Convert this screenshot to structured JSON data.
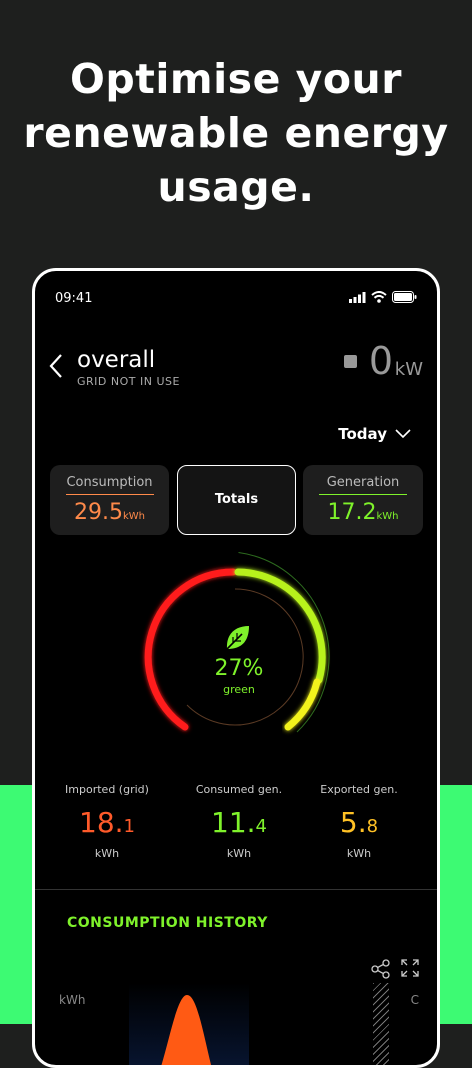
{
  "headline": {
    "line1": "Optimise your",
    "line2": "renewable energy",
    "line3": "usage."
  },
  "status_bar": {
    "time": "09:41"
  },
  "header": {
    "title": "overall",
    "subtitle": "GRID NOT IN USE",
    "power_value": "0",
    "power_unit": "kW"
  },
  "period": {
    "selected": "Today"
  },
  "cards": {
    "consumption": {
      "label": "Consumption",
      "value_main": "29.5",
      "unit": "kWh",
      "color": "#ff8a4a"
    },
    "totals": {
      "label": "Totals"
    },
    "generation": {
      "label": "Generation",
      "value_main": "17.2",
      "unit": "kWh",
      "color": "#7ff22b"
    }
  },
  "gauge": {
    "green_percent": 27,
    "percent_text": "27%",
    "label": "green",
    "colors": {
      "red": "#ff1a1a",
      "green": "#b8f21e",
      "yellow": "#f2f21a",
      "accent": "#7ff22b"
    }
  },
  "stats": {
    "imported": {
      "label": "Imported (grid)",
      "value_main": "18.",
      "value_dec": "1",
      "unit": "kWh",
      "color": "#ff5a2a"
    },
    "consumed_gen": {
      "label": "Consumed gen.",
      "value_main": "11.",
      "value_dec": "4",
      "unit": "kWh",
      "color": "#7ff22b"
    },
    "exported_gen": {
      "label": "Exported gen.",
      "value_main": "5.",
      "value_dec": "8",
      "unit": "kWh",
      "color": "#ffc125"
    }
  },
  "history": {
    "title": "CONSUMPTION HISTORY",
    "y_label": "kWh",
    "right_label": "C"
  },
  "icons": [
    "back-chevron-icon",
    "signal-icon",
    "wifi-icon",
    "battery-icon",
    "chevron-down-icon",
    "leaf-icon",
    "share-icon",
    "expand-icon"
  ]
}
